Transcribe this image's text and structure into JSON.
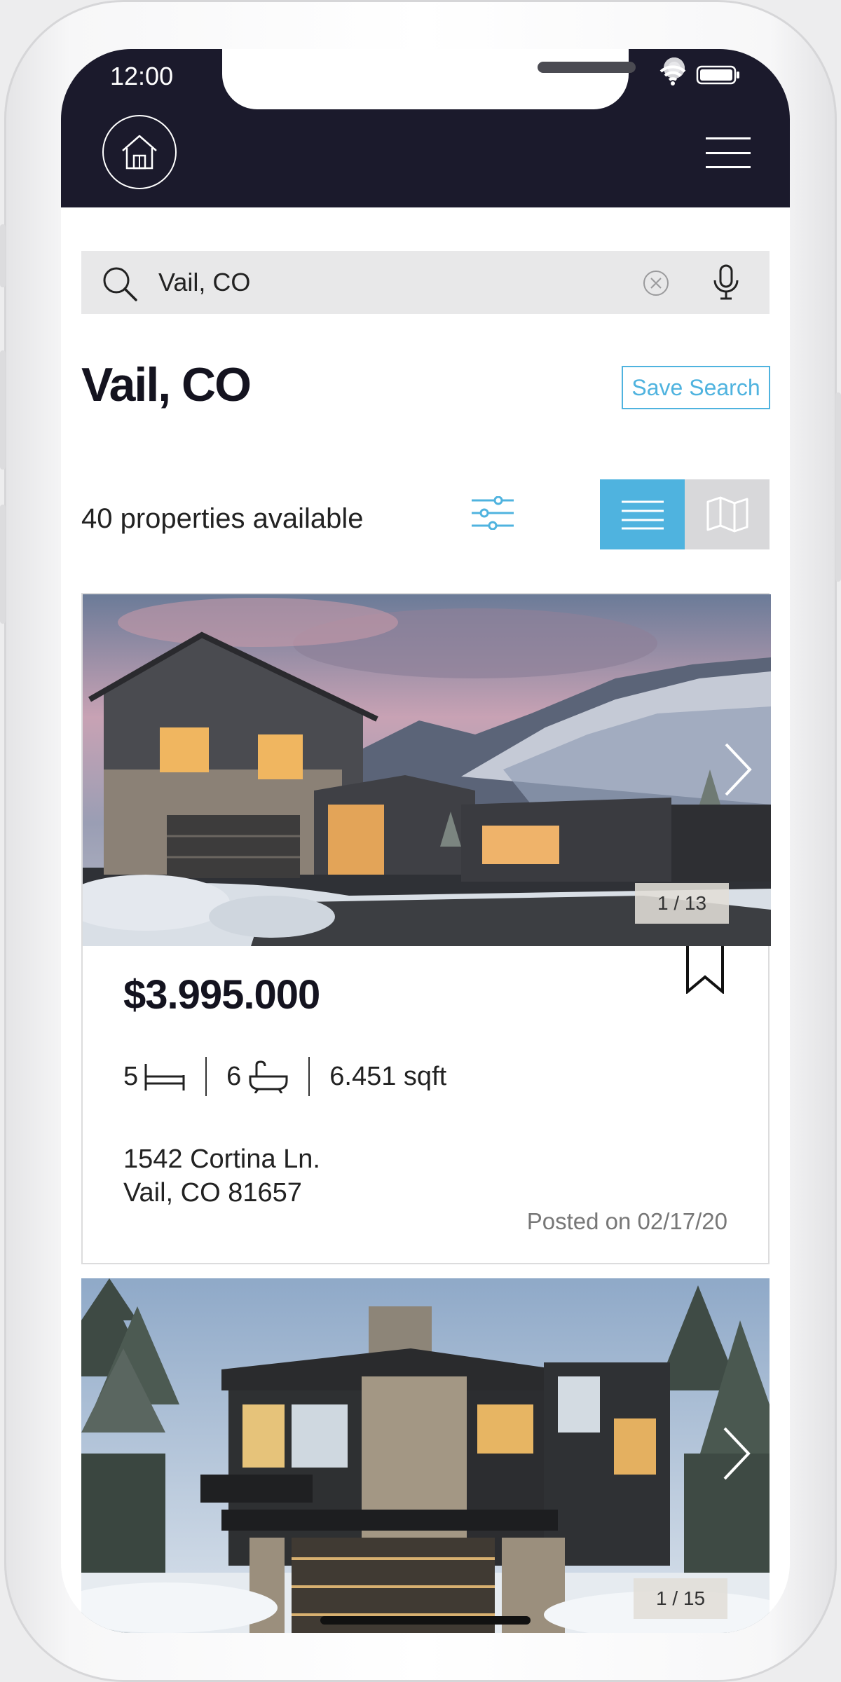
{
  "status_bar": {
    "time": "12:00"
  },
  "header": {
    "home_icon": "house-icon",
    "menu_icon": "hamburger-icon"
  },
  "search": {
    "value": "Vail, CO",
    "placeholder": "Vail, CO"
  },
  "page": {
    "title": "Vail, CO",
    "save_search_label": "Save Search",
    "count_label": "40 properties available"
  },
  "view_toggle": {
    "active": "list",
    "options": [
      "list",
      "map"
    ]
  },
  "accent_color": "#4fb3df",
  "header_color": "#1b1a2c",
  "listings": [
    {
      "photo_counter": "1 / 13",
      "price": "$3.995.000",
      "beds": "5",
      "baths": "6",
      "area": "6.451 sqft",
      "address_line1": "1542 Cortina Ln.",
      "address_line2": "Vail, CO 81657",
      "posted": "Posted on 02/17/20"
    },
    {
      "photo_counter": "1 / 15"
    }
  ]
}
